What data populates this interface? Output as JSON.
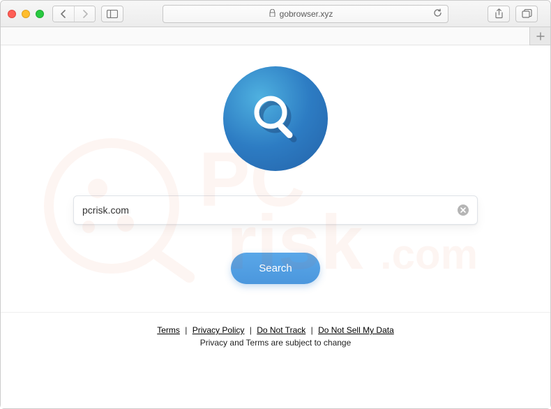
{
  "browser": {
    "url_display": "gobrowser.xyz",
    "secure": true
  },
  "page": {
    "search": {
      "value": "pcrisk.com",
      "placeholder": ""
    },
    "button_label": "Search",
    "footer": {
      "links": {
        "terms": "Terms",
        "privacy": "Privacy Policy",
        "dnt": "Do Not Track",
        "dnsmd": "Do Not Sell My Data"
      },
      "separator": "|",
      "subtext": "Privacy and Terms are subject to change"
    }
  }
}
